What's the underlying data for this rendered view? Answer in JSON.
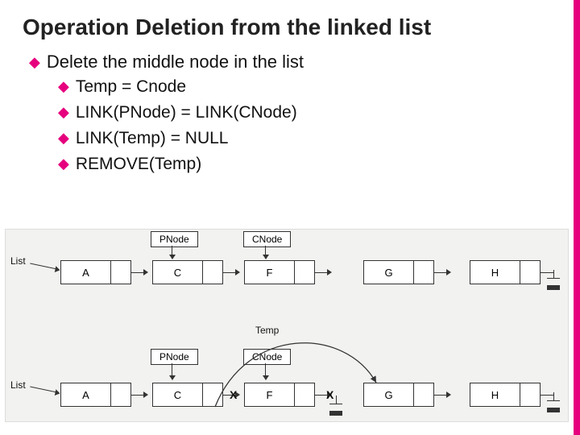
{
  "title": "Operation Deletion from the linked list",
  "bullets": {
    "lvl1": "Delete the middle node in the list",
    "items": [
      "Temp = Cnode",
      "LINK(PNode) = LINK(CNode)",
      "LINK(Temp) = NULL",
      "REMOVE(Temp)"
    ]
  },
  "diagram": {
    "list_label": "List",
    "pointers": {
      "pnode": "PNode",
      "cnode": "CNode",
      "temp": "Temp"
    },
    "row1": [
      "A",
      "C",
      "F",
      "G",
      "H"
    ],
    "row2": [
      "A",
      "C",
      "F",
      "G",
      "H"
    ],
    "x_mark": "X"
  }
}
